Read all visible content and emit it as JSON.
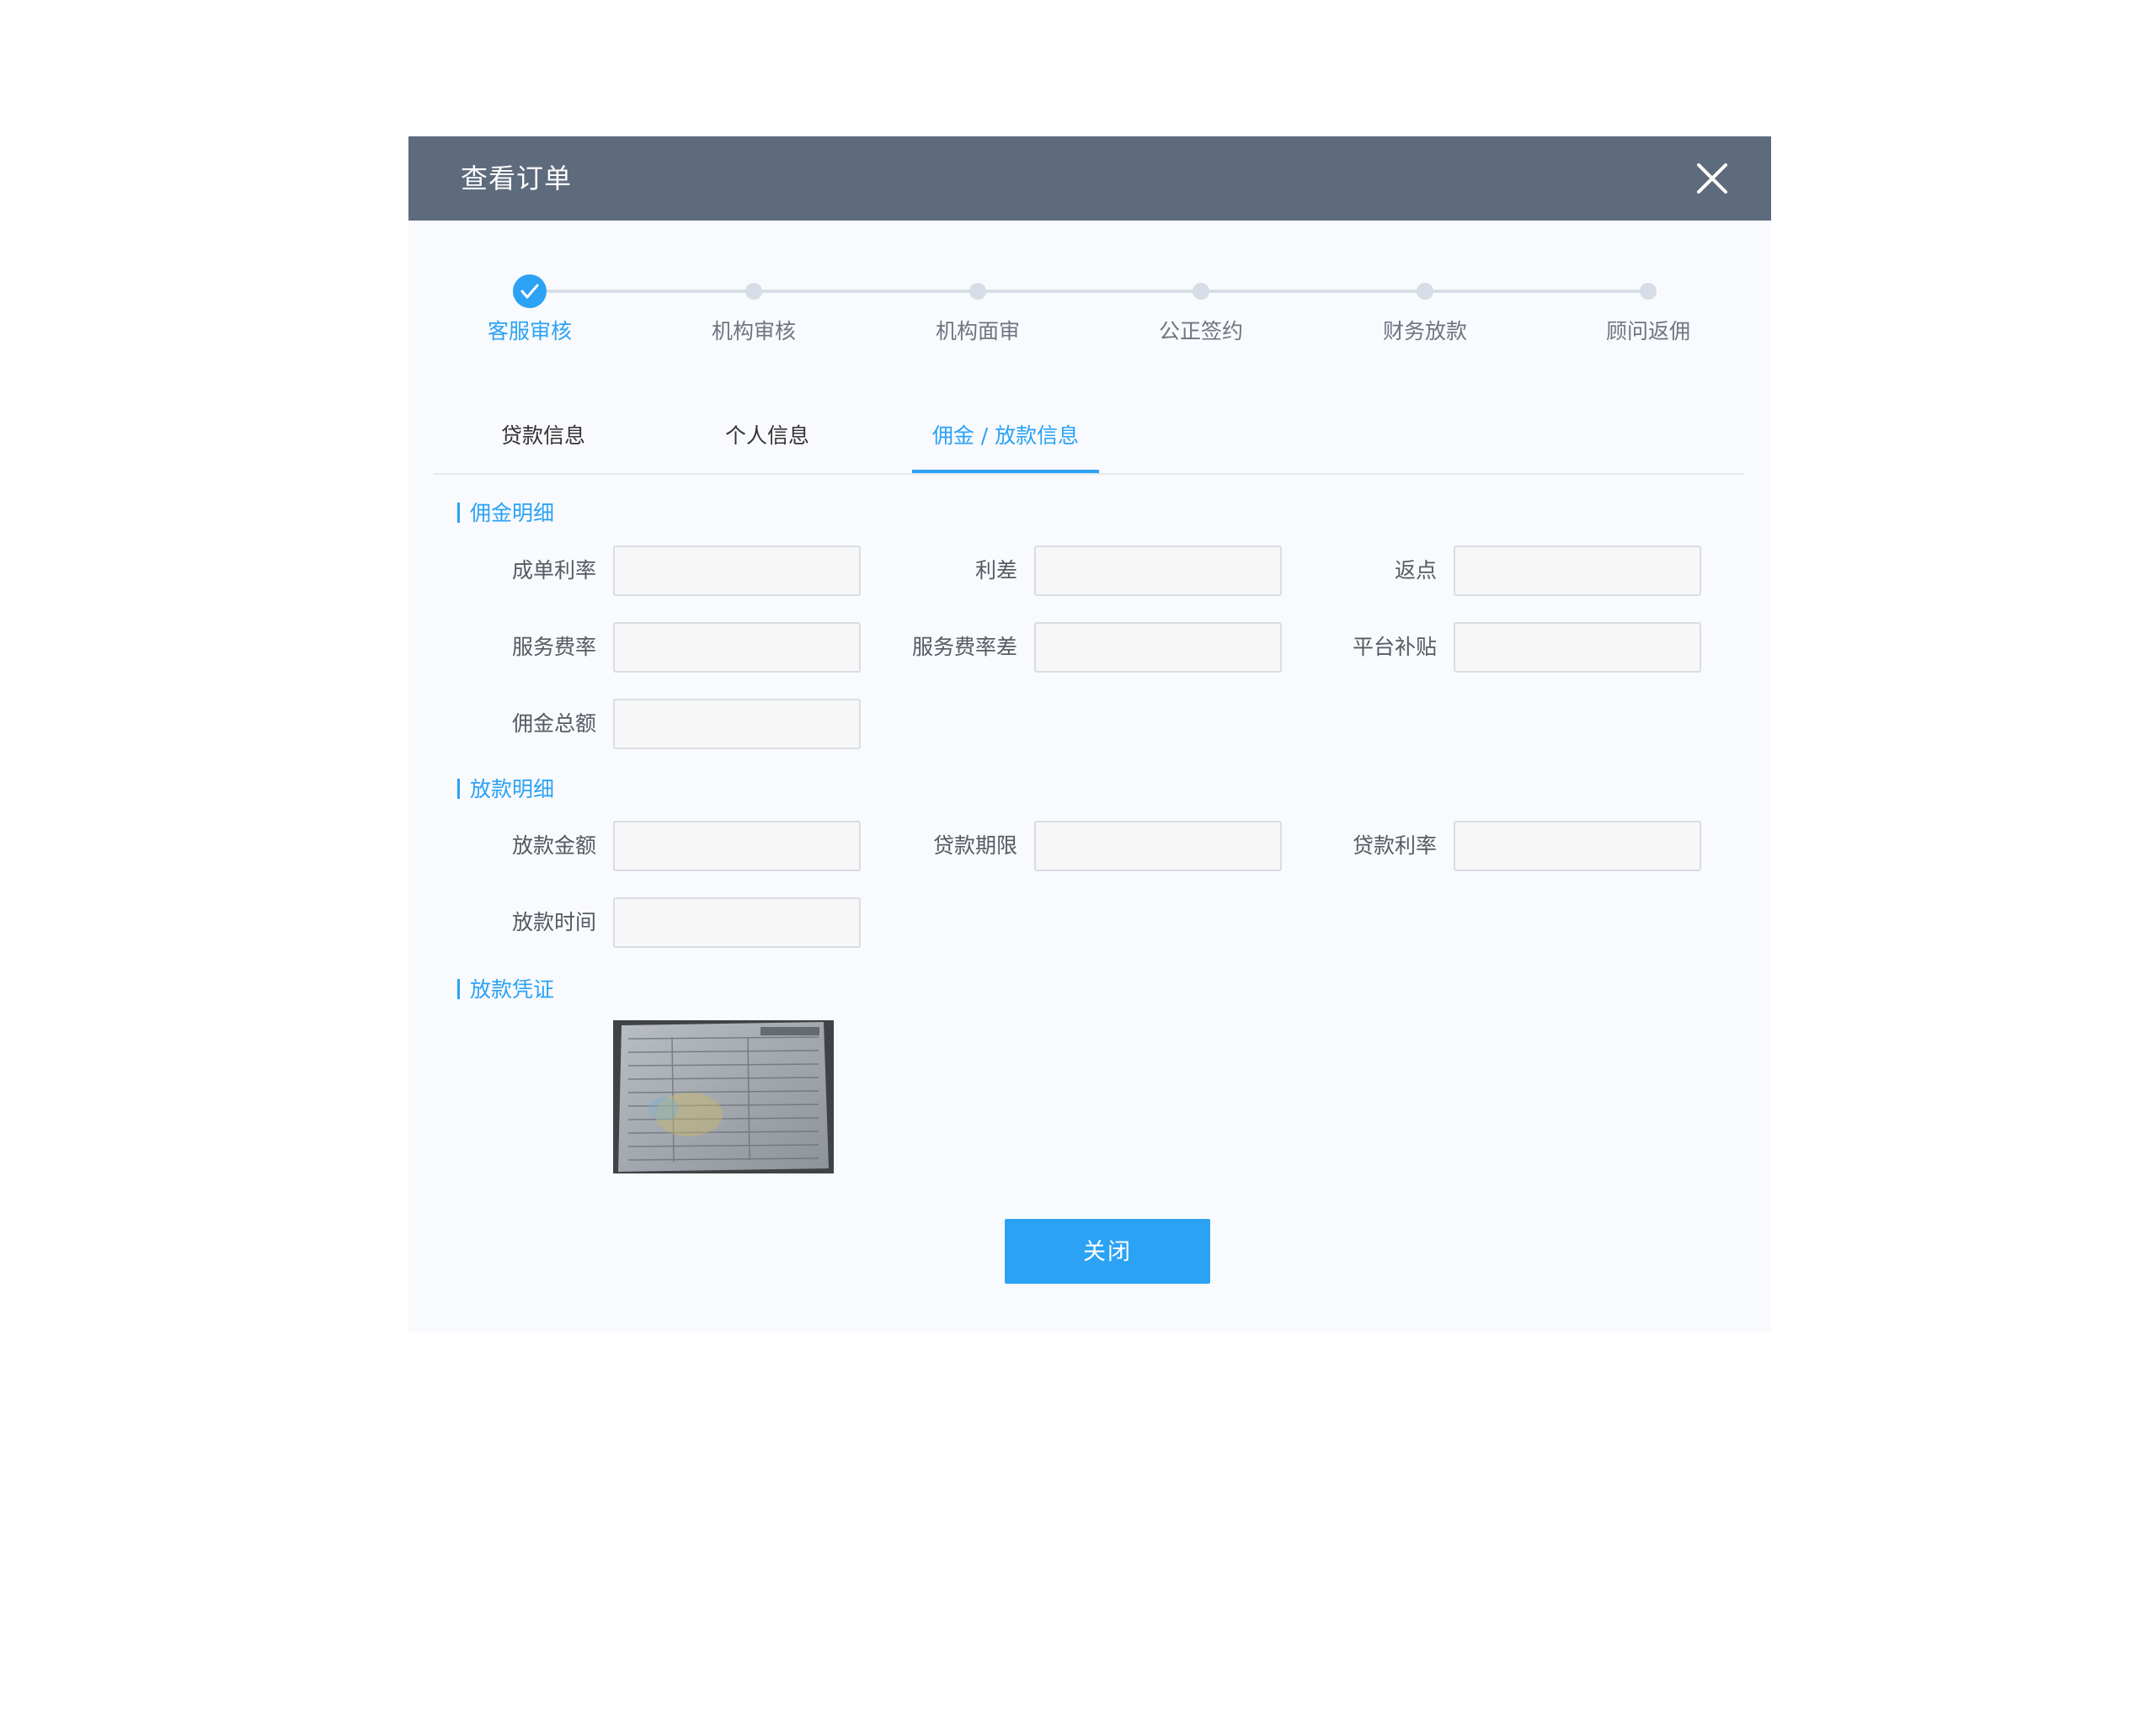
{
  "dialog": {
    "title": "查看订单"
  },
  "steps": [
    {
      "label": "客服审核",
      "state": "done"
    },
    {
      "label": "机构审核",
      "state": "pending"
    },
    {
      "label": "机构面审",
      "state": "pending"
    },
    {
      "label": "公正签约",
      "state": "pending"
    },
    {
      "label": "财务放款",
      "state": "pending"
    },
    {
      "label": "顾问返佣",
      "state": "pending"
    }
  ],
  "tabs": [
    {
      "label": "贷款信息",
      "active": false
    },
    {
      "label": "个人信息",
      "active": false
    },
    {
      "label": "佣金 / 放款信息",
      "active": true
    }
  ],
  "commission": {
    "title": "佣金明细",
    "fields": {
      "deal_rate": {
        "label": "成单利率",
        "value": ""
      },
      "rate_spread": {
        "label": "利差",
        "value": ""
      },
      "rebate": {
        "label": "返点",
        "value": ""
      },
      "service_rate": {
        "label": "服务费率",
        "value": ""
      },
      "service_rate_diff": {
        "label": "服务费率差",
        "value": ""
      },
      "platform_subsidy": {
        "label": "平台补贴",
        "value": ""
      },
      "commission_total": {
        "label": "佣金总额",
        "value": ""
      }
    }
  },
  "loan": {
    "title": "放款明细",
    "fields": {
      "amount": {
        "label": "放款金额",
        "value": ""
      },
      "term": {
        "label": "贷款期限",
        "value": ""
      },
      "rate": {
        "label": "贷款利率",
        "value": ""
      },
      "time": {
        "label": "放款时间",
        "value": ""
      }
    }
  },
  "voucher": {
    "title": "放款凭证"
  },
  "actions": {
    "close_label": "关闭"
  },
  "colors": {
    "header": "#5e6b7d",
    "accent": "#2ca2f5",
    "step_pending": "#d6dde6"
  }
}
